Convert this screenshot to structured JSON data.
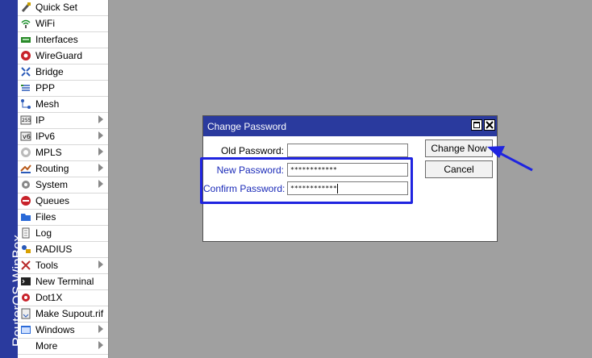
{
  "brand": "RouterOS WinBox",
  "menu": [
    {
      "label": "Quick Set",
      "icon": "quick-set-icon",
      "submenu": false
    },
    {
      "label": "WiFi",
      "icon": "wifi-icon",
      "submenu": false
    },
    {
      "label": "Interfaces",
      "icon": "interfaces-icon",
      "submenu": false
    },
    {
      "label": "WireGuard",
      "icon": "wireguard-icon",
      "submenu": false
    },
    {
      "label": "Bridge",
      "icon": "bridge-icon",
      "submenu": false
    },
    {
      "label": "PPP",
      "icon": "ppp-icon",
      "submenu": false
    },
    {
      "label": "Mesh",
      "icon": "mesh-icon",
      "submenu": false
    },
    {
      "label": "IP",
      "icon": "ip-icon",
      "submenu": true
    },
    {
      "label": "IPv6",
      "icon": "ipv6-icon",
      "submenu": true
    },
    {
      "label": "MPLS",
      "icon": "mpls-icon",
      "submenu": true
    },
    {
      "label": "Routing",
      "icon": "routing-icon",
      "submenu": true
    },
    {
      "label": "System",
      "icon": "system-gear-icon",
      "submenu": true
    },
    {
      "label": "Queues",
      "icon": "queues-icon",
      "submenu": false
    },
    {
      "label": "Files",
      "icon": "files-folder-icon",
      "submenu": false
    },
    {
      "label": "Log",
      "icon": "log-icon",
      "submenu": false
    },
    {
      "label": "RADIUS",
      "icon": "radius-icon",
      "submenu": false
    },
    {
      "label": "Tools",
      "icon": "tools-icon",
      "submenu": true
    },
    {
      "label": "New Terminal",
      "icon": "terminal-icon",
      "submenu": false
    },
    {
      "label": "Dot1X",
      "icon": "dot1x-icon",
      "submenu": false
    },
    {
      "label": "Make Supout.rif",
      "icon": "supout-icon",
      "submenu": false
    },
    {
      "label": "Windows",
      "icon": "windows-icon",
      "submenu": true
    },
    {
      "label": "More",
      "icon": "",
      "submenu": true
    }
  ],
  "dialog": {
    "title": "Change Password",
    "old_password_label": "Old Password:",
    "old_password_value": "",
    "new_password_label": "New Password:",
    "new_password_value": "************",
    "confirm_password_label": "Confirm Password:",
    "confirm_password_value": "************",
    "change_now_label": "Change Now",
    "cancel_label": "Cancel"
  },
  "colors": {
    "accent": "#2a3a9e",
    "highlight": "#1f24e0",
    "arrow": "#1f24e0",
    "desktop": "#a0a0a0"
  }
}
